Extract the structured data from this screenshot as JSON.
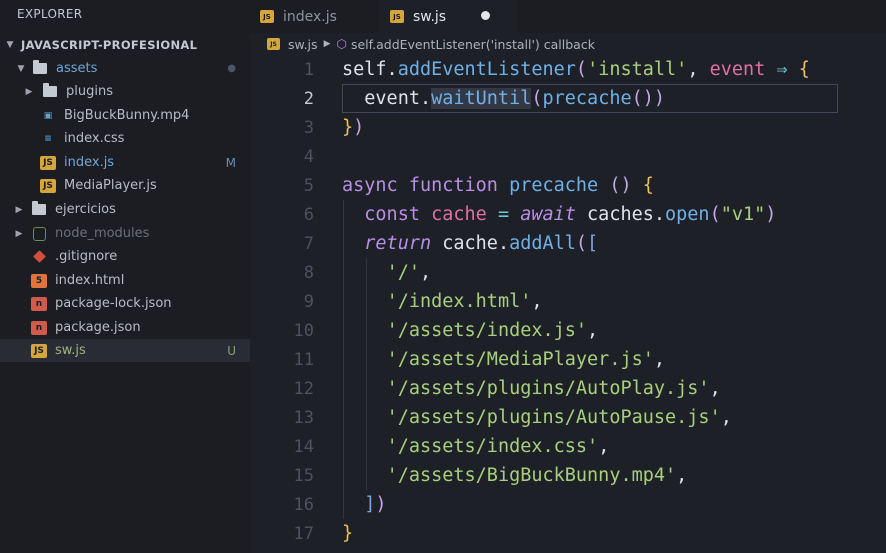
{
  "sidebar": {
    "title": "EXPLORER",
    "project": "JAVASCRIPT-PROFESIONAL",
    "items": [
      {
        "label": "assets",
        "badge": ""
      },
      {
        "label": "plugins"
      },
      {
        "label": "BigBuckBunny.mp4"
      },
      {
        "label": "index.css"
      },
      {
        "label": "index.js",
        "badge": "M"
      },
      {
        "label": "MediaPlayer.js"
      },
      {
        "label": "ejercicios"
      },
      {
        "label": "node_modules"
      },
      {
        "label": ".gitignore"
      },
      {
        "label": "index.html"
      },
      {
        "label": "package-lock.json"
      },
      {
        "label": "package.json"
      },
      {
        "label": "sw.js",
        "badge": "U"
      }
    ],
    "colors": {
      "modified": "#a98b4d",
      "untracked": "#8ea06a",
      "dim": "#6c6f78",
      "active_bg": "#292c35"
    }
  },
  "tabs": [
    {
      "label": "index.js",
      "active": false
    },
    {
      "label": "sw.js",
      "active": true,
      "dirty": true
    }
  ],
  "breadcrumb": {
    "file": "sw.js",
    "symbol": "self.addEventListener('install') callback"
  },
  "editor": {
    "current_line": 2,
    "line_numbers": [
      "1",
      "2",
      "3",
      "4",
      "5",
      "6",
      "7",
      "8",
      "9",
      "10",
      "11",
      "12",
      "13",
      "14",
      "15",
      "16",
      "17"
    ],
    "lines": [
      [
        [
          "plain",
          "self."
        ],
        [
          "fn",
          "addEventListener"
        ],
        [
          "paren",
          "("
        ],
        [
          "str",
          "'install'"
        ],
        [
          "punc",
          ", "
        ],
        [
          "param",
          "event"
        ],
        [
          "op",
          " ⇒ "
        ],
        [
          "brace",
          "{"
        ]
      ],
      [
        [
          "plain",
          "  event."
        ],
        [
          "fnhl",
          "waitUntil"
        ],
        [
          "paren",
          "("
        ],
        [
          "fn",
          "precache"
        ],
        [
          "paren",
          "())"
        ]
      ],
      [
        [
          "brace",
          "}"
        ],
        [
          "paren",
          ")"
        ]
      ],
      [],
      [
        [
          "kw",
          "async "
        ],
        [
          "kw",
          "function "
        ],
        [
          "fn",
          "precache "
        ],
        [
          "paren",
          "() "
        ],
        [
          "brace",
          "{"
        ]
      ],
      [
        [
          "plain",
          "  "
        ],
        [
          "kw",
          "const "
        ],
        [
          "param",
          "cache "
        ],
        [
          "op",
          "= "
        ],
        [
          "kwi",
          "await "
        ],
        [
          "plain",
          "caches."
        ],
        [
          "fn",
          "open"
        ],
        [
          "paren",
          "("
        ],
        [
          "str",
          "\"v1\""
        ],
        [
          "paren",
          ")"
        ]
      ],
      [
        [
          "plain",
          "  "
        ],
        [
          "kwi",
          "return "
        ],
        [
          "plain",
          "cache."
        ],
        [
          "fn",
          "addAll"
        ],
        [
          "paren",
          "("
        ],
        [
          "bracket",
          "["
        ]
      ],
      [
        [
          "plain",
          "    "
        ],
        [
          "str",
          "'/'"
        ],
        [
          "punc",
          ","
        ]
      ],
      [
        [
          "plain",
          "    "
        ],
        [
          "str",
          "'/index.html'"
        ],
        [
          "punc",
          ","
        ]
      ],
      [
        [
          "plain",
          "    "
        ],
        [
          "str",
          "'/assets/index.js'"
        ],
        [
          "punc",
          ","
        ]
      ],
      [
        [
          "plain",
          "    "
        ],
        [
          "str",
          "'/assets/MediaPlayer.js'"
        ],
        [
          "punc",
          ","
        ]
      ],
      [
        [
          "plain",
          "    "
        ],
        [
          "str",
          "'/assets/plugins/AutoPlay.js'"
        ],
        [
          "punc",
          ","
        ]
      ],
      [
        [
          "plain",
          "    "
        ],
        [
          "str",
          "'/assets/plugins/AutoPause.js'"
        ],
        [
          "punc",
          ","
        ]
      ],
      [
        [
          "plain",
          "    "
        ],
        [
          "str",
          "'/assets/index.css'"
        ],
        [
          "punc",
          ","
        ]
      ],
      [
        [
          "plain",
          "    "
        ],
        [
          "str",
          "'/assets/BigBuckBunny.mp4'"
        ],
        [
          "punc",
          ","
        ]
      ],
      [
        [
          "plain",
          "  "
        ],
        [
          "bracket",
          "]"
        ],
        [
          "paren",
          ")"
        ]
      ],
      [
        [
          "brace",
          "}"
        ]
      ]
    ],
    "icon_names": {
      "js": "js-file-icon",
      "folder": "folder-icon",
      "css": "css-file-icon",
      "html": "html-file-icon",
      "json": "json-file-icon",
      "git": "git-icon",
      "node": "node-icon",
      "video": "video-file-icon"
    }
  }
}
